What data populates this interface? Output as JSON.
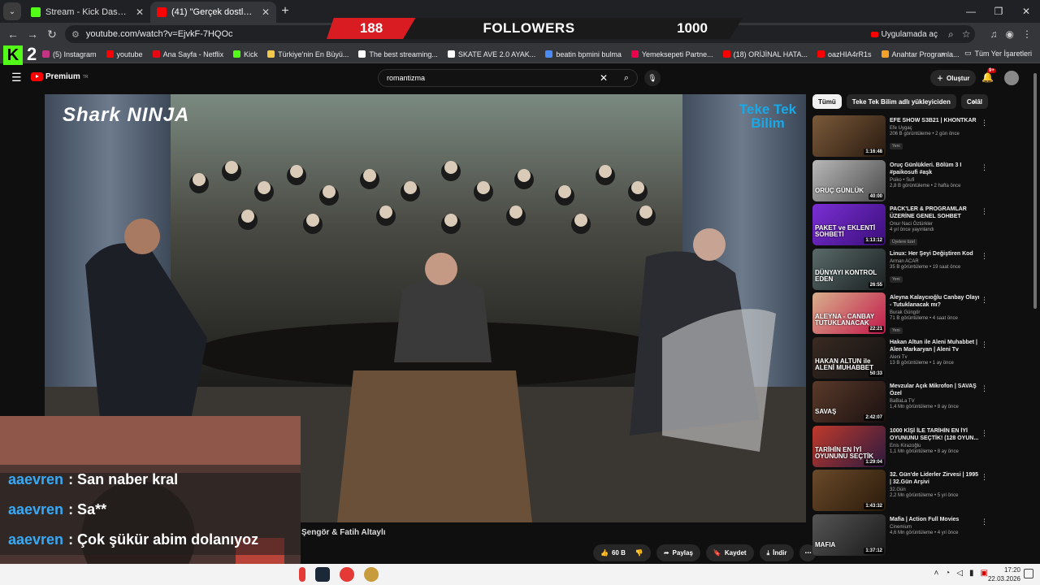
{
  "browser": {
    "tabs": [
      {
        "title": "Stream - Kick Dashboard",
        "favicon_color": "#53fc18"
      },
      {
        "title": "(41) \"Gerçek dostluk ebedidir...\"",
        "favicon_color": "#ff0000"
      }
    ],
    "new_tab": "+",
    "url": "youtube.com/watch?v=EjvkF-7HQOc",
    "open_app_label": "Uygulamada aç",
    "bookmarks": [
      {
        "label": "(5) Instagram",
        "color": "#c13584"
      },
      {
        "label": "youtube",
        "color": "#ff0000"
      },
      {
        "label": "Ana Sayfa - Netflix",
        "color": "#e50914"
      },
      {
        "label": "Kick",
        "color": "#53fc18"
      },
      {
        "label": "Türkiye'nin En Büyü...",
        "color": "#f2c94c"
      },
      {
        "label": "The best streaming...",
        "color": "#ffffff"
      },
      {
        "label": "SKATE AVE 2.0 AYAK...",
        "color": "#ffffff"
      },
      {
        "label": "beatin bpmini bulma",
        "color": "#4b8bf5"
      },
      {
        "label": "Yemeksepeti Partne...",
        "color": "#ea004b"
      },
      {
        "label": "(18) ORİJİNAL HATA...",
        "color": "#ff0000"
      },
      {
        "label": "oazHIA4rR1s",
        "color": "#ff0000"
      },
      {
        "label": "Anahtar Programla...",
        "color": "#f4a12c"
      }
    ],
    "all_bookmarks": "Tüm Yer İşaretleri"
  },
  "stream_overlay": {
    "followers_count": "188",
    "followers_label": "FOLLOWERS",
    "followers_goal": "1000",
    "kick_letter": "K",
    "kick_number": "2",
    "chat": [
      {
        "user": "aaevren",
        "message": ": San naber kral"
      },
      {
        "user": "aaevren",
        "message": ": Sa**"
      },
      {
        "user": "aaevren",
        "message": ": Çok şükür abim dolanıyoz"
      }
    ],
    "video_title_partial": "Şengör & Fatih Altaylı"
  },
  "youtube": {
    "logo_text": "Premium",
    "logo_sup": "TR",
    "search_value": "romantizma",
    "create_label": "Oluştur",
    "notif_count": "9+",
    "video_watermark_left": "Shark NINJA",
    "video_watermark_right": "Teke Tek Bilim",
    "actions": {
      "like_count": "60 B",
      "share": "Paylaş",
      "save": "Kaydet",
      "download": "İndir"
    },
    "chips": [
      "Tümü",
      "Teke Tek Bilim adlı yükleyiciden",
      "Celâl"
    ],
    "recommendations": [
      {
        "title": "EFE SHOW S3B21 | KHONTKAR",
        "channel": "Efe Uygaç",
        "meta": "206 B görüntüleme • 2 gün önce",
        "badge": "Yeni",
        "duration": "1:16:48",
        "thumb_text": "",
        "c1": "#7a5a3a",
        "c2": "#2a1a10"
      },
      {
        "title": "Oruç Günlükleri. Bölüm 3 I #paikosufi #aşk",
        "channel": "Psiko • Sufi",
        "meta": "2,8 B görüntüleme • 2 hafta önce",
        "badge": "",
        "duration": "40:00",
        "thumb_text": "ORUÇ GÜNLÜK",
        "c1": "#b8b8b8",
        "c2": "#4a4a4a"
      },
      {
        "title": "PACK'LER & PROGRAMLAR ÜZERİNE GENEL SOHBET",
        "channel": "Onur Naci Öztürkler",
        "meta": "4 yıl önce yayınlandı",
        "badge": "Üyelere özel",
        "duration": "1:13:12",
        "thumb_text": "PAKET ve EKLENTİ SOHBETİ",
        "c1": "#7b2fd4",
        "c2": "#3a0e7a"
      },
      {
        "title": "Linux: Her Şeyi Değiştiren Kod",
        "channel": "Arman ACAR",
        "meta": "35 B görüntüleme • 19 saat önce",
        "badge": "Yeni",
        "duration": "26:55",
        "thumb_text": "DÜNYAYI KONTROL EDEN",
        "c1": "#5a6a6a",
        "c2": "#1a2020"
      },
      {
        "title": "Aleyna Kalaycıoğlu Canbay Olayı - Tutuklanacak mı?",
        "channel": "Burak Güngör",
        "meta": "71 B görüntüleme • 4 saat önce",
        "badge": "Yeni",
        "duration": "22:21",
        "thumb_text": "ALEYNA - CANBAY TUTUKLANACAK",
        "c1": "#d9b08c",
        "c2": "#c2184a"
      },
      {
        "title": "Hakan Altun ile Aleni Muhabbet | Alen Markaryan | Aleni Tv",
        "channel": "Aleni Tv",
        "meta": "13 B görüntüleme • 1 ay önce",
        "badge": "",
        "duration": "50:33",
        "thumb_text": "HAKAN ALTUN ile ALENİ MUHABBET",
        "c1": "#3a2a22",
        "c2": "#111111"
      },
      {
        "title": "Mevzular Açık Mikrofon | SAVAŞ Özel",
        "channel": "BaBaLa TV",
        "meta": "1,4 Mn görüntüleme • 8 ay önce",
        "badge": "",
        "duration": "2:42:07",
        "thumb_text": "SAVAŞ",
        "c1": "#5a3a2a",
        "c2": "#1a1010"
      },
      {
        "title": "1000 KİŞİ İLE TARİHİN EN İYİ OYUNUNU SEÇTİK! (128 OYUN...",
        "channel": "Enis Kirazoğlu",
        "meta": "1,1 Mn görüntüleme • 8 ay önce",
        "badge": "",
        "duration": "1:29:04",
        "thumb_text": "TARİHİN EN İYİ OYUNUNU SEÇTİK",
        "c1": "#c0392b",
        "c2": "#2c1a40"
      },
      {
        "title": "32. Gün'de Liderler Zirvesi | 1995 | 32.Gün Arşivi",
        "channel": "32.Gün",
        "meta": "2,2 Mn görüntüleme • 5 yıl önce",
        "badge": "",
        "duration": "1:43:32",
        "thumb_text": "",
        "c1": "#6a4a2a",
        "c2": "#2a1a0a"
      },
      {
        "title": "Mafia | Action Full Movies",
        "channel": "Cinemium",
        "meta": "4,6 Mn görüntüleme • 4 yıl önce",
        "badge": "",
        "duration": "1:37:12",
        "thumb_text": "MAFIA",
        "c1": "#555555",
        "c2": "#1a1a1a"
      }
    ]
  },
  "taskbar": {
    "time": "17:20",
    "date": "22.03.2026"
  }
}
